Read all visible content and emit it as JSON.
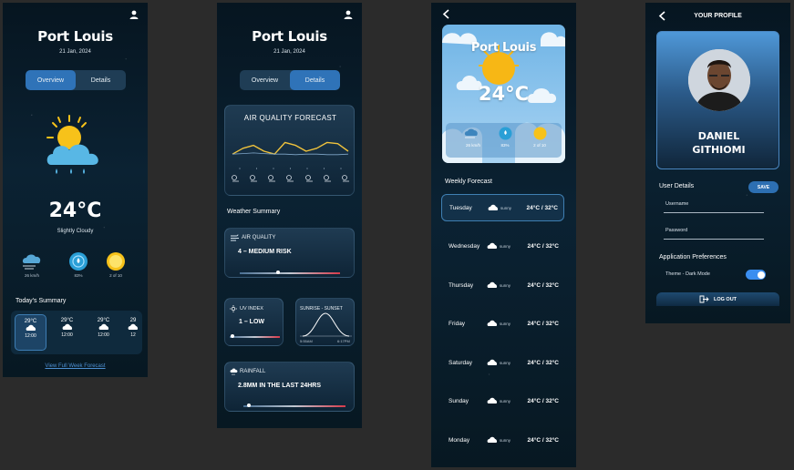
{
  "home": {
    "city": "Port Louis",
    "date": "21 Jan, 2024",
    "tabs": [
      "Overview",
      "Details"
    ],
    "temperature": "24°C",
    "condition": "Slightly Cloudy",
    "stats": [
      {
        "icon": "wind-icon",
        "label": "26 km/h"
      },
      {
        "icon": "humidity-icon",
        "label": "83%"
      },
      {
        "icon": "sun-icon",
        "label": "2 of 10"
      }
    ],
    "summary_title": "Today's Summary",
    "hours": [
      {
        "temp": "29°C",
        "time": "12:00"
      },
      {
        "temp": "29°C",
        "time": "12:00"
      },
      {
        "temp": "29°C",
        "time": "12:00"
      },
      {
        "temp": "29",
        "time": "12"
      }
    ],
    "link": "View Full Week Forecast"
  },
  "details": {
    "city": "Port Louis",
    "date": "21 Jan, 2024",
    "tabs": [
      "Overview",
      "Details"
    ],
    "aq_forecast_title": "AIR QUALITY FORECAST",
    "weather_summary_title": "Weather Summary",
    "air_quality": {
      "title": "AIR QUALITY",
      "value": "4 – MEDIUM RISK",
      "level": 0.38
    },
    "uv_index": {
      "title": "UV INDEX",
      "value": "1 – LOW",
      "level": 0.05
    },
    "sunrise": {
      "title": "SUNRISE - SUNSET",
      "rise": "5:55AM",
      "set": "6:17PM"
    },
    "rainfall": {
      "title": "RAINFALL",
      "value": "2.8MM IN THE LAST 24HRS",
      "level": 0.05
    },
    "chart_data": {
      "type": "line",
      "series": [
        {
          "values": [
            2,
            3,
            3.5,
            2.5,
            2,
            4,
            3.5,
            2.5,
            3,
            4,
            3.8,
            2.5
          ]
        },
        {
          "values": [
            2,
            2.1,
            2.2,
            2.1,
            2.0,
            2.0,
            1.9,
            2.0,
            2.0,
            1.9,
            1.9,
            2.0
          ]
        }
      ]
    }
  },
  "weekly": {
    "city": "Port Louis",
    "temperature": "24°C",
    "stats": [
      {
        "icon": "wind-icon",
        "label": "26 km/h"
      },
      {
        "icon": "humidity-icon",
        "label": "83%"
      },
      {
        "icon": "sun-icon",
        "label": "2 of 10"
      }
    ],
    "title": "Weekly Forecast",
    "days": [
      {
        "day": "Tuesday",
        "cond": "sunny",
        "temp": "24°C / 32°C"
      },
      {
        "day": "Wednesday",
        "cond": "sunny",
        "temp": "24°C / 32°C"
      },
      {
        "day": "Thursday",
        "cond": "sunny",
        "temp": "24°C / 32°C"
      },
      {
        "day": "Friday",
        "cond": "sunny",
        "temp": "24°C / 32°C"
      },
      {
        "day": "Saturday",
        "cond": "sunny",
        "temp": "24°C / 32°C"
      },
      {
        "day": "Sunday",
        "cond": "sunny",
        "temp": "24°C / 32°C"
      },
      {
        "day": "Monday",
        "cond": "sunny",
        "temp": "24°C / 32°C"
      }
    ]
  },
  "profile": {
    "title": "YOUR PROFILE",
    "name_line1": "DANIEL",
    "name_line2": "GITHIOMI",
    "user_details": "User Details",
    "save": "SAVE",
    "username_placeholder": "Username",
    "password_placeholder": "Password",
    "app_prefs": "Application Preferences",
    "theme": "Theme - Dark Mode",
    "logout": "LOG OUT"
  },
  "colors": {
    "accent": "#2f73b8",
    "toggle": "#3a8ef0",
    "sun": "#f7c21a",
    "cloud": "#5ab8e6"
  }
}
